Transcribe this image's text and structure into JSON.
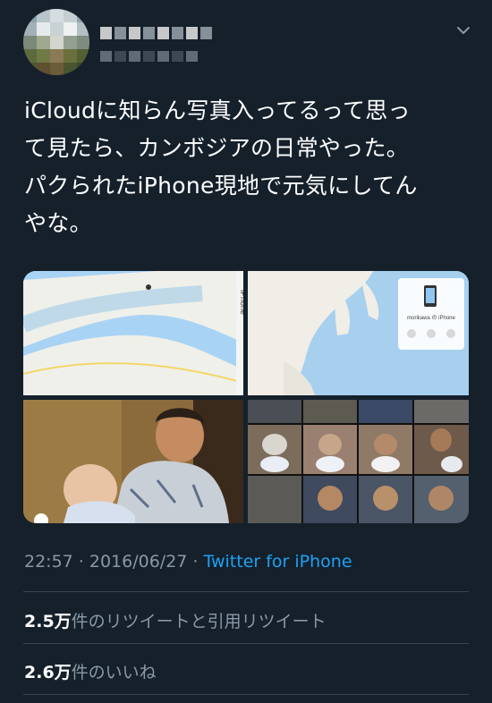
{
  "header": {
    "avatar_alt": "profile picture (blurred)",
    "menu_icon": "chevron-down-icon"
  },
  "tweet": {
    "text": "iCloudに知らん写真入ってるって思っ\nて見たら、カンボジアの日常やった。\nパクられたiPhone現地で元気にしてん\nやな。",
    "timestamp": "22:57 · 2016/06/27 · ",
    "source": "Twitter for iPhone"
  },
  "media": {
    "map_label": "iPhone",
    "device_panel_title": "morikawa の iPhone"
  },
  "stats": {
    "retweets_count": "2.5万",
    "retweets_label": "件のリツイートと引用リツイート",
    "likes_count": "2.6万",
    "likes_label": "件のいいね"
  },
  "colors": {
    "background": "#15202b",
    "text": "#ffffff",
    "muted": "#8899a6",
    "link": "#1da1f2",
    "divider": "#38444d"
  }
}
